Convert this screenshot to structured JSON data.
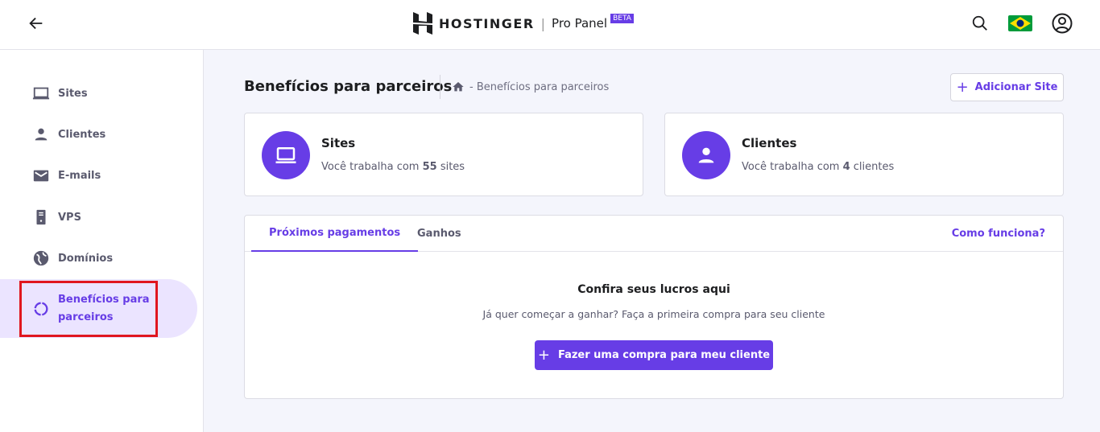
{
  "header": {
    "brand": "HOSTINGER",
    "product": "Pro Panel",
    "badge": "BETA",
    "separator": "|"
  },
  "sidebar": {
    "items": [
      {
        "label": "Sites",
        "icon": "laptop-icon"
      },
      {
        "label": "Clientes",
        "icon": "person-icon"
      },
      {
        "label": "E-mails",
        "icon": "mail-icon"
      },
      {
        "label": "VPS",
        "icon": "server-icon"
      },
      {
        "label": "Domínios",
        "icon": "globe-icon"
      },
      {
        "label": "Benefícios para parceiros",
        "icon": "partner-ring-icon",
        "active": true
      }
    ]
  },
  "page": {
    "title": "Benefícios para parceiros",
    "breadcrumb": "- Benefícios para parceiros",
    "add_site": "Adicionar Site"
  },
  "cards": [
    {
      "title": "Sites",
      "prefix": "Você trabalha com ",
      "count": "55",
      "suffix": " sites"
    },
    {
      "title": "Clientes",
      "prefix": "Você trabalha com ",
      "count": "4",
      "suffix": " clientes"
    }
  ],
  "panel": {
    "tabs": [
      "Próximos pagamentos",
      "Ganhos"
    ],
    "help": "Como funciona?",
    "empty_title": "Confira seus lucros aqui",
    "empty_sub": "Já quer começar a ganhar? Faça a primeira compra para seu cliente",
    "cta": "Fazer uma compra para meu cliente"
  },
  "colors": {
    "accent": "#673de6",
    "highlight": "#e0161f"
  }
}
